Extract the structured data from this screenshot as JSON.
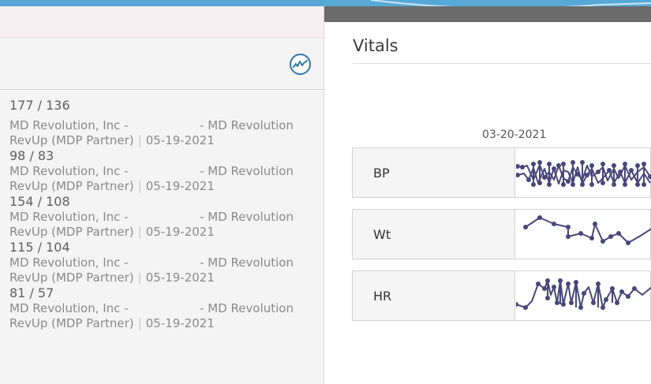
{
  "vitals_panel": {
    "title": "Vitals",
    "date": "03-20-2021",
    "rows": [
      {
        "label": "BP"
      },
      {
        "label": "Wt"
      },
      {
        "label": "HR"
      }
    ]
  },
  "readings": [
    {
      "value": "177 / 136",
      "org": "MD Revolution, Inc -",
      "org_suffix": "- MD Revolution",
      "partner": "RevUp (MDP Partner)",
      "date": "05-19-2021"
    },
    {
      "value": "98 / 83",
      "org": "MD Revolution, Inc -",
      "org_suffix": "- MD Revolution",
      "partner": "RevUp (MDP Partner)",
      "date": "05-19-2021"
    },
    {
      "value": "154 / 108",
      "org": "MD Revolution, Inc -",
      "org_suffix": "- MD Revolution",
      "partner": "RevUp (MDP Partner)",
      "date": "05-19-2021"
    },
    {
      "value": "115 / 104",
      "org": "MD Revolution, Inc -",
      "org_suffix": "- MD Revolution",
      "partner": "RevUp (MDP Partner)",
      "date": "05-19-2021"
    },
    {
      "value": "81 / 57",
      "org": "MD Revolution, Inc -",
      "org_suffix": "- MD Revolution",
      "partner": "RevUp (MDP Partner)",
      "date": "05-19-2021"
    }
  ],
  "colors": {
    "accent": "#2f79a8",
    "spark": "#4a4679",
    "topbar": "#6b6b6b"
  },
  "icons": {
    "chart_button": "line-chart-icon"
  }
}
